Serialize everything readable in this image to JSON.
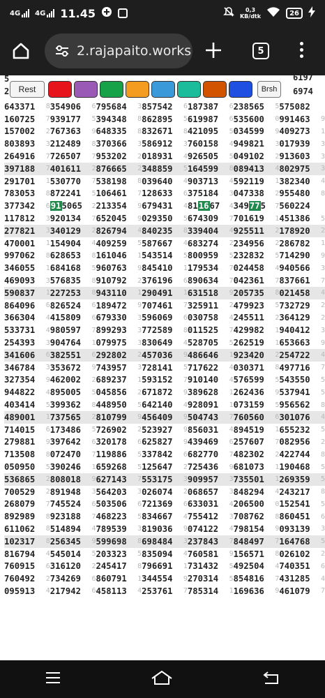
{
  "status_bar": {
    "sim1": "4G",
    "sim2": "4G",
    "time": "11.45",
    "net_speed_value": "0,3",
    "net_speed_unit": "KB/dtk",
    "battery": "26"
  },
  "browser": {
    "url": "2.rajapaito.works",
    "tab_count": "5"
  },
  "toolbar": {
    "rest_label": "Rest",
    "brush_label": "Brsh",
    "colors": [
      "#e8141c",
      "#9b59b6",
      "#17a249",
      "#f39c1f",
      "#3a9ad9",
      "#1abc9c",
      "#d35400",
      "#1f4fe0"
    ]
  },
  "partial_rows": {
    "top_left_a": "5",
    "top_left_b": "2",
    "top_right_a": "6197",
    "top_right_b": "6974"
  },
  "rows": [
    {
      "cells": [
        "643371",
        "354906",
        "795684",
        "857542",
        "187387",
        "238565",
        "575082"
      ],
      "seps": [
        "8",
        "6",
        "3",
        "6",
        "6",
        "5",
        ""
      ]
    },
    {
      "cells": [
        "160725",
        "939177",
        "394348",
        "862895",
        "619987",
        "535600",
        "991463"
      ],
      "seps": [
        "7",
        "5",
        "8",
        "5",
        "6",
        "0",
        "9"
      ]
    },
    {
      "cells": [
        "157002",
        "767363",
        "648335",
        "832671",
        "421095",
        "034599",
        "409273"
      ],
      "seps": [
        "2",
        "9",
        "8",
        "8",
        "5",
        "9",
        "1"
      ]
    },
    {
      "cells": [
        "803893",
        "212489",
        "370366",
        "586912",
        "760158",
        "949821",
        "017939"
      ],
      "seps": [
        "3",
        "8",
        "3",
        "3",
        "4",
        "3",
        "3"
      ]
    },
    {
      "cells": [
        "264916",
        "726507",
        "953202",
        "018931",
        "926505",
        "049102",
        "913603"
      ],
      "seps": [
        "7",
        "7",
        "2",
        "4",
        "5",
        "2",
        "3"
      ]
    },
    {
      "cells": [
        "397188",
        "401611",
        "876665",
        "348859",
        "164599",
        "089413",
        "802975"
      ],
      "seps": [
        "7",
        "2",
        "2",
        "5",
        "8",
        "4",
        "3"
      ]
    },
    {
      "cells": [
        "291701",
        "530770",
        "538198",
        "039640",
        "903713",
        "592119",
        "382340"
      ],
      "seps": [
        "1",
        "7",
        "8",
        "4",
        "4",
        "1",
        "4"
      ]
    },
    {
      "cells": [
        "783053",
        "872241",
        "106461",
        "128633",
        "375184",
        "047338",
        "955480"
      ],
      "seps": [
        "8",
        "5",
        "7",
        "6",
        "3",
        "2",
        "8"
      ]
    },
    {
      "cells": [
        "377342",
        "915065",
        "213354",
        "679431",
        "811667",
        "349775",
        "560224"
      ],
      "seps": [
        "6",
        "2",
        "9",
        "4",
        "4",
        "7",
        ""
      ]
    },
    {
      "cells": [
        "117812",
        "920134",
        "652045",
        "029350",
        "674309",
        "701619",
        "451386"
      ],
      "seps": [
        "3",
        "7",
        "9",
        "5",
        "7",
        "1",
        "5"
      ]
    },
    {
      "cells": [
        "277821",
        "340129",
        "826794",
        "840235",
        "339404",
        "925511",
        "178920"
      ],
      "seps": [
        "3",
        "2",
        "4",
        "8",
        "4",
        "2",
        "2"
      ]
    },
    {
      "cells": [
        "470001",
        "154904",
        "409259",
        "587667",
        "683274",
        "234956",
        "286782"
      ],
      "seps": [
        "1",
        "4",
        "5",
        "4",
        "2",
        "2",
        "1"
      ]
    },
    {
      "cells": [
        "997062",
        "628653",
        "161046",
        "543514",
        "800959",
        "232832",
        "714290"
      ],
      "seps": [
        "8",
        "8",
        "1",
        "5",
        "5",
        "5",
        "9"
      ]
    },
    {
      "cells": [
        "346055",
        "684168",
        "960763",
        "845410",
        "179534",
        "024458",
        "940566"
      ],
      "seps": [
        "1",
        "5",
        "9",
        "1",
        "7",
        "4",
        "3"
      ]
    },
    {
      "cells": [
        "469093",
        "576835",
        "910792",
        "376196",
        "890634",
        "042361",
        "837661"
      ],
      "seps": [
        "3",
        "8",
        "2",
        "6",
        "7",
        "7",
        "7"
      ]
    },
    {
      "cells": [
        "590837",
        "227253",
        "943110",
        "290491",
        "631518",
        "205735",
        "021458"
      ],
      "seps": [
        "1",
        "8",
        "1",
        "1",
        "9",
        "8",
        "4"
      ]
    },
    {
      "cells": [
        "864096",
        "826524",
        "189472",
        "707461",
        "325911",
        "479923",
        "732729"
      ],
      "seps": [
        "6",
        "6",
        "9",
        "7",
        "2",
        "5",
        "2"
      ]
    },
    {
      "cells": [
        "366304",
        "415809",
        "679330",
        "596069",
        "030758",
        "245511",
        "364129"
      ],
      "seps": [
        "4",
        "6",
        "3",
        "6",
        "4",
        "2",
        "2"
      ]
    },
    {
      "cells": [
        "533731",
        "980597",
        "899293",
        "772589",
        "011525",
        "429982",
        "940412"
      ],
      "seps": [
        "4",
        "7",
        "3",
        "8",
        "7",
        "1",
        "3"
      ]
    },
    {
      "cells": [
        "254393",
        "904764",
        "079975",
        "830649",
        "528705",
        "262519",
        "653663"
      ],
      "seps": [
        "3",
        "1",
        "3",
        "4",
        "5",
        "1",
        "9"
      ]
    },
    {
      "cells": [
        "341606",
        "382551",
        "292802",
        "457036",
        "486646",
        "923420",
        "254722"
      ],
      "seps": [
        "6",
        "6",
        "2",
        "9",
        "1",
        "2",
        "4"
      ]
    },
    {
      "cells": [
        "346784",
        "353672",
        "743957",
        "728141",
        "717622",
        "030371",
        "497716"
      ],
      "seps": [
        "3",
        "9",
        "3",
        "5",
        "4",
        "8",
        "7"
      ]
    },
    {
      "cells": [
        "327354",
        "462002",
        "689237",
        "593152",
        "910140",
        "576599",
        "543550"
      ],
      "seps": [
        "9",
        "2",
        "1",
        "7",
        "4",
        "5",
        "5"
      ]
    },
    {
      "cells": [
        "944822",
        "895005",
        "045856",
        "671872",
        "389628",
        "262436",
        "537941"
      ],
      "seps": [
        "4",
        "5",
        "2",
        "9",
        "1",
        "9",
        "5"
      ]
    },
    {
      "cells": [
        "403414",
        "399362",
        "448950",
        "642140",
        "928091",
        "073159",
        "956562"
      ],
      "seps": [
        "5",
        "8",
        "5",
        "4",
        "1",
        "5",
        "8"
      ]
    },
    {
      "cells": [
        "489001",
        "737565",
        "810799",
        "456409",
        "504743",
        "760560",
        "301076"
      ],
      "seps": [
        "1",
        "2",
        "9",
        "9",
        "7",
        "6",
        "4"
      ]
    },
    {
      "cells": [
        "714015",
        "173486",
        "726902",
        "523927",
        "856031",
        "894519",
        "655232"
      ],
      "seps": [
        "6",
        "5",
        "2",
        "9",
        "4",
        "1",
        "5"
      ]
    },
    {
      "cells": [
        "279881",
        "397642",
        "320178",
        "625827",
        "439469",
        "257607",
        "082956"
      ],
      "seps": [
        "9",
        "6",
        "6",
        "9",
        "6",
        "7",
        "2"
      ]
    },
    {
      "cells": [
        "713508",
        "072470",
        "119886",
        "337842",
        "682770",
        "482302",
        "422744"
      ],
      "seps": [
        "8",
        "7",
        "5",
        "6",
        "7",
        "2",
        "8"
      ]
    },
    {
      "cells": [
        "050950",
        "390246",
        "659268",
        "125647",
        "725436",
        "681073",
        "190468"
      ],
      "seps": [
        "5",
        "1",
        "5",
        "2",
        "9",
        "1",
        "5"
      ]
    },
    {
      "cells": [
        "536865",
        "808018",
        "627143",
        "553175",
        "909957",
        "735501",
        "269359"
      ],
      "seps": [
        "2",
        "9",
        "7",
        "3",
        "3",
        "1",
        "5"
      ]
    },
    {
      "cells": [
        "700529",
        "891948",
        "564203",
        "026074",
        "068657",
        "848294",
        "243217"
      ],
      "seps": [
        "2",
        "3",
        "3",
        "2",
        "3",
        "4",
        "8"
      ]
    },
    {
      "cells": [
        "268079",
        "745524",
        "503506",
        "721369",
        "633031",
        "206500",
        "152541"
      ],
      "seps": [
        "7",
        "6",
        "6",
        "6",
        "4",
        "0",
        "5"
      ]
    },
    {
      "cells": [
        "892989",
        "923188",
        "468223",
        "834667",
        "755412",
        "708762",
        "860451"
      ],
      "seps": [
        "8",
        "7",
        "5",
        "4",
        "3",
        "8",
        "6"
      ]
    },
    {
      "cells": [
        "611062",
        "514894",
        "789539",
        "819036",
        "074122",
        "798154",
        "093139"
      ],
      "seps": [
        "8",
        "4",
        "3",
        "9",
        "4",
        "9",
        "3"
      ]
    },
    {
      "cells": [
        "102317",
        "256345",
        "599698",
        "698484",
        "237843",
        "848497",
        "164768"
      ],
      "seps": [
        "8",
        "9",
        "8",
        "3",
        "7",
        "7",
        "5"
      ]
    },
    {
      "cells": [
        "816794",
        "545014",
        "203323",
        "835094",
        "760581",
        "156571",
        "026102"
      ],
      "seps": [
        "4",
        "5",
        "5",
        "4",
        "9",
        "8",
        "2"
      ]
    },
    {
      "cells": [
        "760915",
        "316120",
        "245417",
        "796691",
        "731432",
        "492504",
        "740351"
      ],
      "seps": [
        "6",
        "2",
        "8",
        "1",
        "5",
        "4",
        "6"
      ]
    },
    {
      "cells": [
        "760492",
        "734269",
        "860791",
        "344554",
        "270314",
        "854816",
        "431285"
      ],
      "seps": [
        "2",
        "6",
        "1",
        "9",
        "5",
        "7",
        "4"
      ]
    },
    {
      "cells": [
        "095913",
        "217942",
        "458113",
        "253761",
        "785314",
        "169636",
        "461079"
      ],
      "seps": [
        "4",
        "6",
        "4",
        "7",
        "1",
        "9",
        "7"
      ]
    }
  ]
}
